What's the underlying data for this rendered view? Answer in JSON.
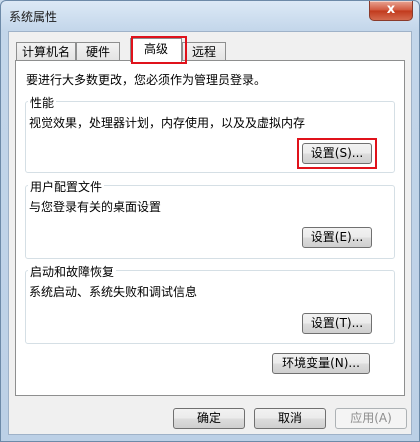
{
  "window": {
    "title": "系统属性",
    "close_glyph": "x"
  },
  "tabs": [
    {
      "label": "计算机名"
    },
    {
      "label": "硬件"
    },
    {
      "label": "高级"
    },
    {
      "label": "远程"
    }
  ],
  "active_tab": "高级",
  "notice": "要进行大多数更改，您必须作为管理员登录。",
  "groups": {
    "performance": {
      "title": "性能",
      "desc": "视觉效果，处理器计划，内存使用，以及及虚拟内存",
      "button": "设置(S)..."
    },
    "user_profiles": {
      "title": "用户配置文件",
      "desc": "与您登录有关的桌面设置",
      "button": "设置(E)..."
    },
    "startup": {
      "title": "启动和故障恢复",
      "desc": "系统启动、系统失败和调试信息",
      "button": "设置(T)..."
    }
  },
  "env_button": "环境变量(N)...",
  "footer": {
    "ok": "确定",
    "cancel": "取消",
    "apply": "应用(A)"
  },
  "highlight_color": "#e0121b"
}
